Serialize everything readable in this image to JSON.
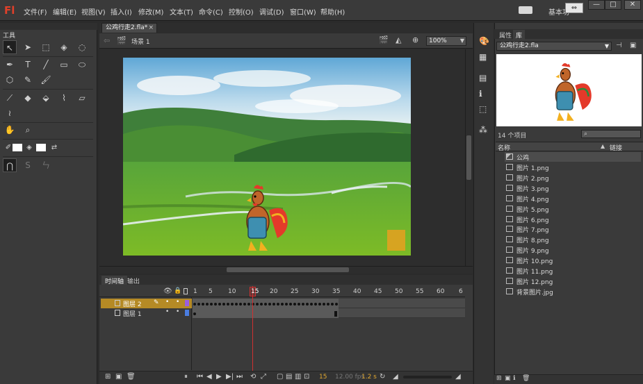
{
  "app": {
    "logo": "Fl"
  },
  "menubar": {
    "items": [
      "文件(F)",
      "编辑(E)",
      "视图(V)",
      "插入(I)",
      "修改(M)",
      "文本(T)",
      "命令(C)",
      "控制(O)",
      "调试(D)",
      "窗口(W)",
      "帮助(H)"
    ],
    "workspace_label": "基本功",
    "window_controls": [
      "—",
      "□",
      "✕"
    ]
  },
  "tools": {
    "title": "工具"
  },
  "document": {
    "tab_label": "公鸡行走2.fla*",
    "tab_close": "×",
    "scene_label": "场景 1",
    "zoom": "100%"
  },
  "timeline": {
    "tabs": [
      "时间轴",
      "输出"
    ],
    "frame_numbers": [
      "1",
      "5",
      "10",
      "15",
      "20",
      "25",
      "30",
      "35",
      "40",
      "45",
      "50",
      "55",
      "60",
      "6"
    ],
    "current_frame_label": "15",
    "layers": [
      {
        "name": "图层 2",
        "selected": true
      },
      {
        "name": "图层 1",
        "selected": false
      }
    ],
    "current_frame": "15",
    "fps": "12.00 fps",
    "time": "1.2 s"
  },
  "library": {
    "tabs": [
      "属性",
      "库"
    ],
    "file": "公鸡行走2.fla",
    "count": "14 个项目",
    "col_name": "名称",
    "col_link": "链接",
    "items": [
      {
        "name": "公鸡",
        "type": "symbol"
      },
      {
        "name": "图片 1.png",
        "type": "bitmap"
      },
      {
        "name": "图片 2.png",
        "type": "bitmap"
      },
      {
        "name": "图片 3.png",
        "type": "bitmap"
      },
      {
        "name": "图片 4.png",
        "type": "bitmap"
      },
      {
        "name": "图片 5.png",
        "type": "bitmap"
      },
      {
        "name": "图片 6.png",
        "type": "bitmap"
      },
      {
        "name": "图片 7.png",
        "type": "bitmap"
      },
      {
        "name": "图片 8.png",
        "type": "bitmap"
      },
      {
        "name": "图片 9.png",
        "type": "bitmap"
      },
      {
        "name": "图片 10.png",
        "type": "bitmap"
      },
      {
        "name": "图片 11.png",
        "type": "bitmap"
      },
      {
        "name": "图片 12.png",
        "type": "bitmap"
      },
      {
        "name": "背景图片.jpg",
        "type": "bitmap"
      }
    ]
  },
  "colors": {
    "accent": "#b58a25",
    "playhead": "#d03030",
    "logo": "#e0402a"
  }
}
